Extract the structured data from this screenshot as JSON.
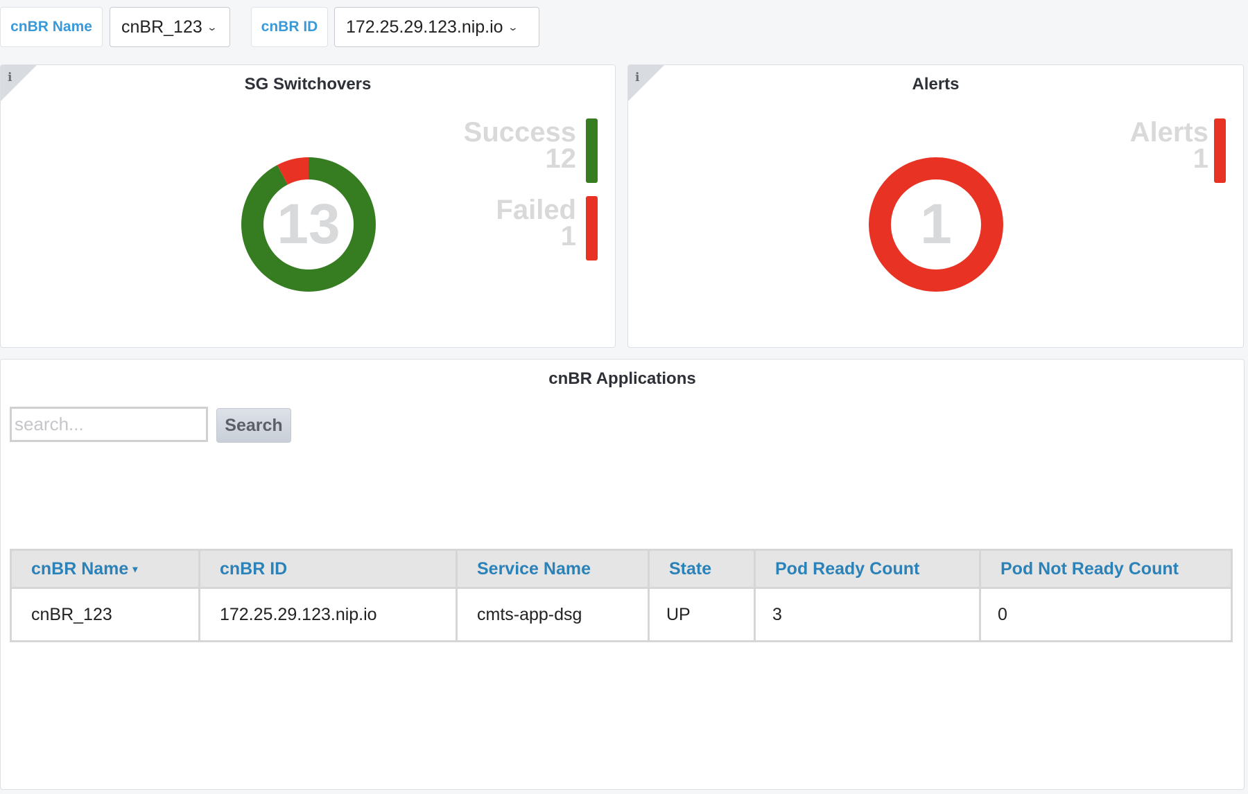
{
  "variables": [
    {
      "label": "cnBR Name",
      "value": "cnBR_123"
    },
    {
      "label": "cnBR ID",
      "value": "172.25.29.123.nip.io"
    }
  ],
  "icons": {
    "dropdown": "chevron-down-icon",
    "info": "info-icon",
    "sort": "sort-desc-icon"
  },
  "panels": {
    "switchovers": {
      "title": "SG Switchovers",
      "info_glyph": "i",
      "total": "13",
      "legend": [
        {
          "label": "Success",
          "value": "12",
          "color": "#367d22"
        },
        {
          "label": "Failed",
          "value": "1",
          "color": "#e83223"
        }
      ]
    },
    "alerts": {
      "title": "Alerts",
      "info_glyph": "i",
      "total": "1",
      "legend": [
        {
          "label": "Alerts",
          "value": "1",
          "color": "#e83223"
        }
      ]
    },
    "applications": {
      "title": "cnBR Applications",
      "search_placeholder": "search...",
      "search_value": "",
      "search_button": "Search",
      "columns": [
        "cnBR Name",
        "cnBR ID",
        "Service Name",
        "State",
        "Pod Ready Count",
        "Pod Not Ready Count"
      ],
      "sort_indicator": "▾",
      "rows": [
        [
          "cnBR_123",
          "172.25.29.123.nip.io",
          "cmts-app-dsg",
          "UP",
          "3",
          "0"
        ]
      ]
    }
  },
  "chart_data": [
    {
      "type": "pie",
      "title": "SG Switchovers",
      "categories": [
        "Success",
        "Failed"
      ],
      "values": [
        12,
        1
      ],
      "colors": [
        "#367d22",
        "#e83223"
      ],
      "center_label": "13",
      "legend": "right"
    },
    {
      "type": "pie",
      "title": "Alerts",
      "categories": [
        "Alerts"
      ],
      "values": [
        1
      ],
      "colors": [
        "#e83223"
      ],
      "center_label": "1",
      "legend": "right"
    }
  ]
}
